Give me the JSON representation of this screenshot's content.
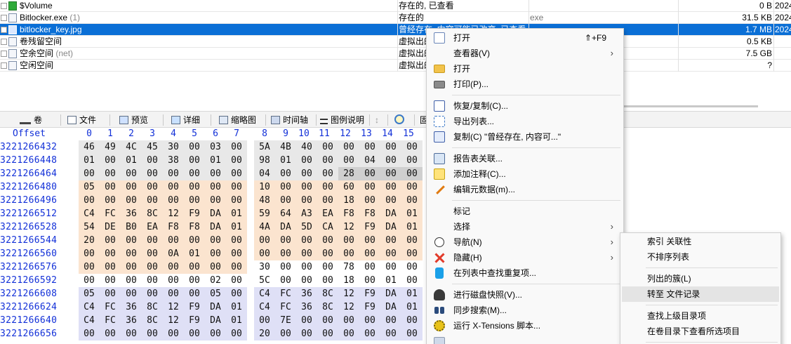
{
  "file_list": {
    "rows": [
      {
        "name": "$Volume",
        "count": "",
        "state": "存在的, 已查看",
        "type": "",
        "size": "0 B",
        "date": "2024",
        "icon": "volume-file-icon",
        "selected": false
      },
      {
        "name": "Bitlocker.exe",
        "count": "(1)",
        "state": "存在的",
        "type": "exe",
        "size": "31.5 KB",
        "date": "2024",
        "icon": "exe-file-icon",
        "selected": false
      },
      {
        "name": "bitlocker_key.jpg",
        "count": "",
        "state": "曾经存在, 内容可能已改变, 已查看",
        "type": "",
        "size": "1.7 MB",
        "date": "2024",
        "icon": "image-file-icon",
        "selected": true
      },
      {
        "name": "卷残留空间",
        "count": "",
        "state": "虚拟出的",
        "type": "",
        "size": "0.5 KB",
        "date": "",
        "icon": "virtual-file-icon",
        "selected": false
      },
      {
        "name": "空余空间",
        "count": "(net)",
        "state": "虚拟出的",
        "type": "",
        "size": "7.5 GB",
        "date": "",
        "icon": "virtual-file-icon",
        "selected": false
      },
      {
        "name": "空闲空间",
        "count": "",
        "state": "虚拟出的",
        "type": "",
        "size": "?",
        "date": "",
        "icon": "virtual-file-icon",
        "selected": false
      }
    ]
  },
  "tabs": [
    {
      "label": "卷",
      "icon": "volume-icon"
    },
    {
      "label": "文件",
      "icon": "file-icon"
    },
    {
      "label": "预览",
      "icon": "preview-icon"
    },
    {
      "label": "详细",
      "icon": "details-icon"
    },
    {
      "label": "缩略图",
      "icon": "thumbnail-icon"
    },
    {
      "label": "时间轴",
      "icon": "timeline-icon"
    },
    {
      "label": "图例说明",
      "icon": "legend-icon"
    },
    {
      "label": "↕",
      "icon": ""
    },
    {
      "label": "",
      "icon": "search-icon"
    },
    {
      "label": "固",
      "icon": ""
    }
  ],
  "hex": {
    "offset_label": "Offset",
    "columns": [
      "0",
      "1",
      "2",
      "3",
      "4",
      "5",
      "6",
      "7",
      "8",
      "9",
      "10",
      "11",
      "12",
      "13",
      "14",
      "15"
    ],
    "rows": [
      {
        "offset": "3221266432",
        "bytes": [
          "46",
          "49",
          "4C",
          "45",
          "30",
          "00",
          "03",
          "00",
          "5A",
          "4B",
          "40",
          "00",
          "00",
          "00",
          "00",
          "00"
        ]
      },
      {
        "offset": "3221266448",
        "bytes": [
          "01",
          "00",
          "01",
          "00",
          "38",
          "00",
          "01",
          "00",
          "98",
          "01",
          "00",
          "00",
          "00",
          "04",
          "00",
          "00"
        ]
      },
      {
        "offset": "3221266464",
        "bytes": [
          "00",
          "00",
          "00",
          "00",
          "00",
          "00",
          "00",
          "00",
          "04",
          "00",
          "00",
          "00",
          "28",
          "00",
          "00",
          "00"
        ]
      },
      {
        "offset": "3221266480",
        "bytes": [
          "05",
          "00",
          "00",
          "00",
          "00",
          "00",
          "00",
          "00",
          "10",
          "00",
          "00",
          "00",
          "60",
          "00",
          "00",
          "00"
        ]
      },
      {
        "offset": "3221266496",
        "bytes": [
          "00",
          "00",
          "00",
          "00",
          "00",
          "00",
          "00",
          "00",
          "48",
          "00",
          "00",
          "00",
          "18",
          "00",
          "00",
          "00"
        ]
      },
      {
        "offset": "3221266512",
        "bytes": [
          "C4",
          "FC",
          "36",
          "8C",
          "12",
          "F9",
          "DA",
          "01",
          "59",
          "64",
          "A3",
          "EA",
          "F8",
          "F8",
          "DA",
          "01"
        ]
      },
      {
        "offset": "3221266528",
        "bytes": [
          "54",
          "DE",
          "B0",
          "EA",
          "F8",
          "F8",
          "DA",
          "01",
          "4A",
          "DA",
          "5D",
          "CA",
          "12",
          "F9",
          "DA",
          "01"
        ]
      },
      {
        "offset": "3221266544",
        "bytes": [
          "20",
          "00",
          "00",
          "00",
          "00",
          "00",
          "00",
          "00",
          "00",
          "00",
          "00",
          "00",
          "00",
          "00",
          "00",
          "00"
        ]
      },
      {
        "offset": "3221266560",
        "bytes": [
          "00",
          "00",
          "00",
          "00",
          "0A",
          "01",
          "00",
          "00",
          "00",
          "00",
          "00",
          "00",
          "00",
          "00",
          "00",
          "00"
        ]
      },
      {
        "offset": "3221266576",
        "bytes": [
          "00",
          "00",
          "00",
          "00",
          "00",
          "00",
          "00",
          "00",
          "30",
          "00",
          "00",
          "00",
          "78",
          "00",
          "00",
          "00"
        ]
      },
      {
        "offset": "3221266592",
        "bytes": [
          "00",
          "00",
          "00",
          "00",
          "00",
          "00",
          "02",
          "00",
          "5C",
          "00",
          "00",
          "00",
          "18",
          "00",
          "01",
          "00"
        ]
      },
      {
        "offset": "3221266608",
        "bytes": [
          "05",
          "00",
          "00",
          "00",
          "00",
          "00",
          "05",
          "00",
          "C4",
          "FC",
          "36",
          "8C",
          "12",
          "F9",
          "DA",
          "01"
        ]
      },
      {
        "offset": "3221266624",
        "bytes": [
          "C4",
          "FC",
          "36",
          "8C",
          "12",
          "F9",
          "DA",
          "01",
          "C4",
          "FC",
          "36",
          "8C",
          "12",
          "F9",
          "DA",
          "01"
        ]
      },
      {
        "offset": "3221266640",
        "bytes": [
          "C4",
          "FC",
          "36",
          "8C",
          "12",
          "F9",
          "DA",
          "01",
          "00",
          "7E",
          "00",
          "00",
          "00",
          "00",
          "00",
          "00"
        ]
      },
      {
        "offset": "3221266656",
        "bytes": [
          "00",
          "00",
          "00",
          "00",
          "00",
          "00",
          "00",
          "00",
          "20",
          "00",
          "00",
          "00",
          "00",
          "00",
          "00",
          "00"
        ]
      }
    ]
  },
  "context_menu": {
    "items": [
      {
        "label": "打开",
        "shortcut": "⇑+F9",
        "arrow": "",
        "icon": "open-icon"
      },
      {
        "label": "查看器(V)",
        "shortcut": "",
        "arrow": "›",
        "icon": ""
      },
      {
        "label": "打开",
        "shortcut": "",
        "arrow": "",
        "icon": "folder-icon"
      },
      {
        "label": "打印(P)...",
        "shortcut": "",
        "arrow": "",
        "icon": "print-icon"
      },
      {
        "label": "恢复/复制(C)...",
        "shortcut": "",
        "arrow": "",
        "icon": "recover-copy-icon"
      },
      {
        "label": "导出列表...",
        "shortcut": "",
        "arrow": "",
        "icon": "export-list-icon"
      },
      {
        "label": "复制(C) \"曾经存在, 内容可...\"",
        "shortcut": "",
        "arrow": "",
        "icon": "copy-icon"
      },
      {
        "label": "报告表关联...",
        "shortcut": "",
        "arrow": "",
        "icon": "report-icon"
      },
      {
        "label": "添加注释(C)...",
        "shortcut": "",
        "arrow": "",
        "icon": "comment-icon"
      },
      {
        "label": "编辑元数据(m)...",
        "shortcut": "",
        "arrow": "",
        "icon": "edit-metadata-icon"
      },
      {
        "label": "标记",
        "shortcut": "",
        "arrow": "",
        "icon": ""
      },
      {
        "label": "选择",
        "shortcut": "",
        "arrow": "›",
        "icon": ""
      },
      {
        "label": "导航(N)",
        "shortcut": "",
        "arrow": "›",
        "icon": "compass-icon"
      },
      {
        "label": "隐藏(H)",
        "shortcut": "",
        "arrow": "›",
        "icon": "hide-icon"
      },
      {
        "label": "在列表中查找重复项...",
        "shortcut": "",
        "arrow": "",
        "icon": "find-duplicates-icon"
      },
      {
        "label": "进行磁盘快照(V)...",
        "shortcut": "",
        "arrow": "",
        "icon": "snapshot-icon"
      },
      {
        "label": "同步搜索(M)...",
        "shortcut": "",
        "arrow": "",
        "icon": "sync-search-icon"
      },
      {
        "label": "运行 X-Tensions 脚本...",
        "shortcut": "",
        "arrow": "",
        "icon": "xtensions-icon"
      }
    ]
  },
  "submenu": {
    "items": [
      {
        "label": "索引 关联性"
      },
      {
        "label": "不排序列表"
      },
      {
        "label": "列出的簇(L)"
      },
      {
        "label": "转至 文件记录"
      },
      {
        "label": "查找上级目录项"
      },
      {
        "label": "在卷目录下查看所选项目"
      }
    ]
  }
}
